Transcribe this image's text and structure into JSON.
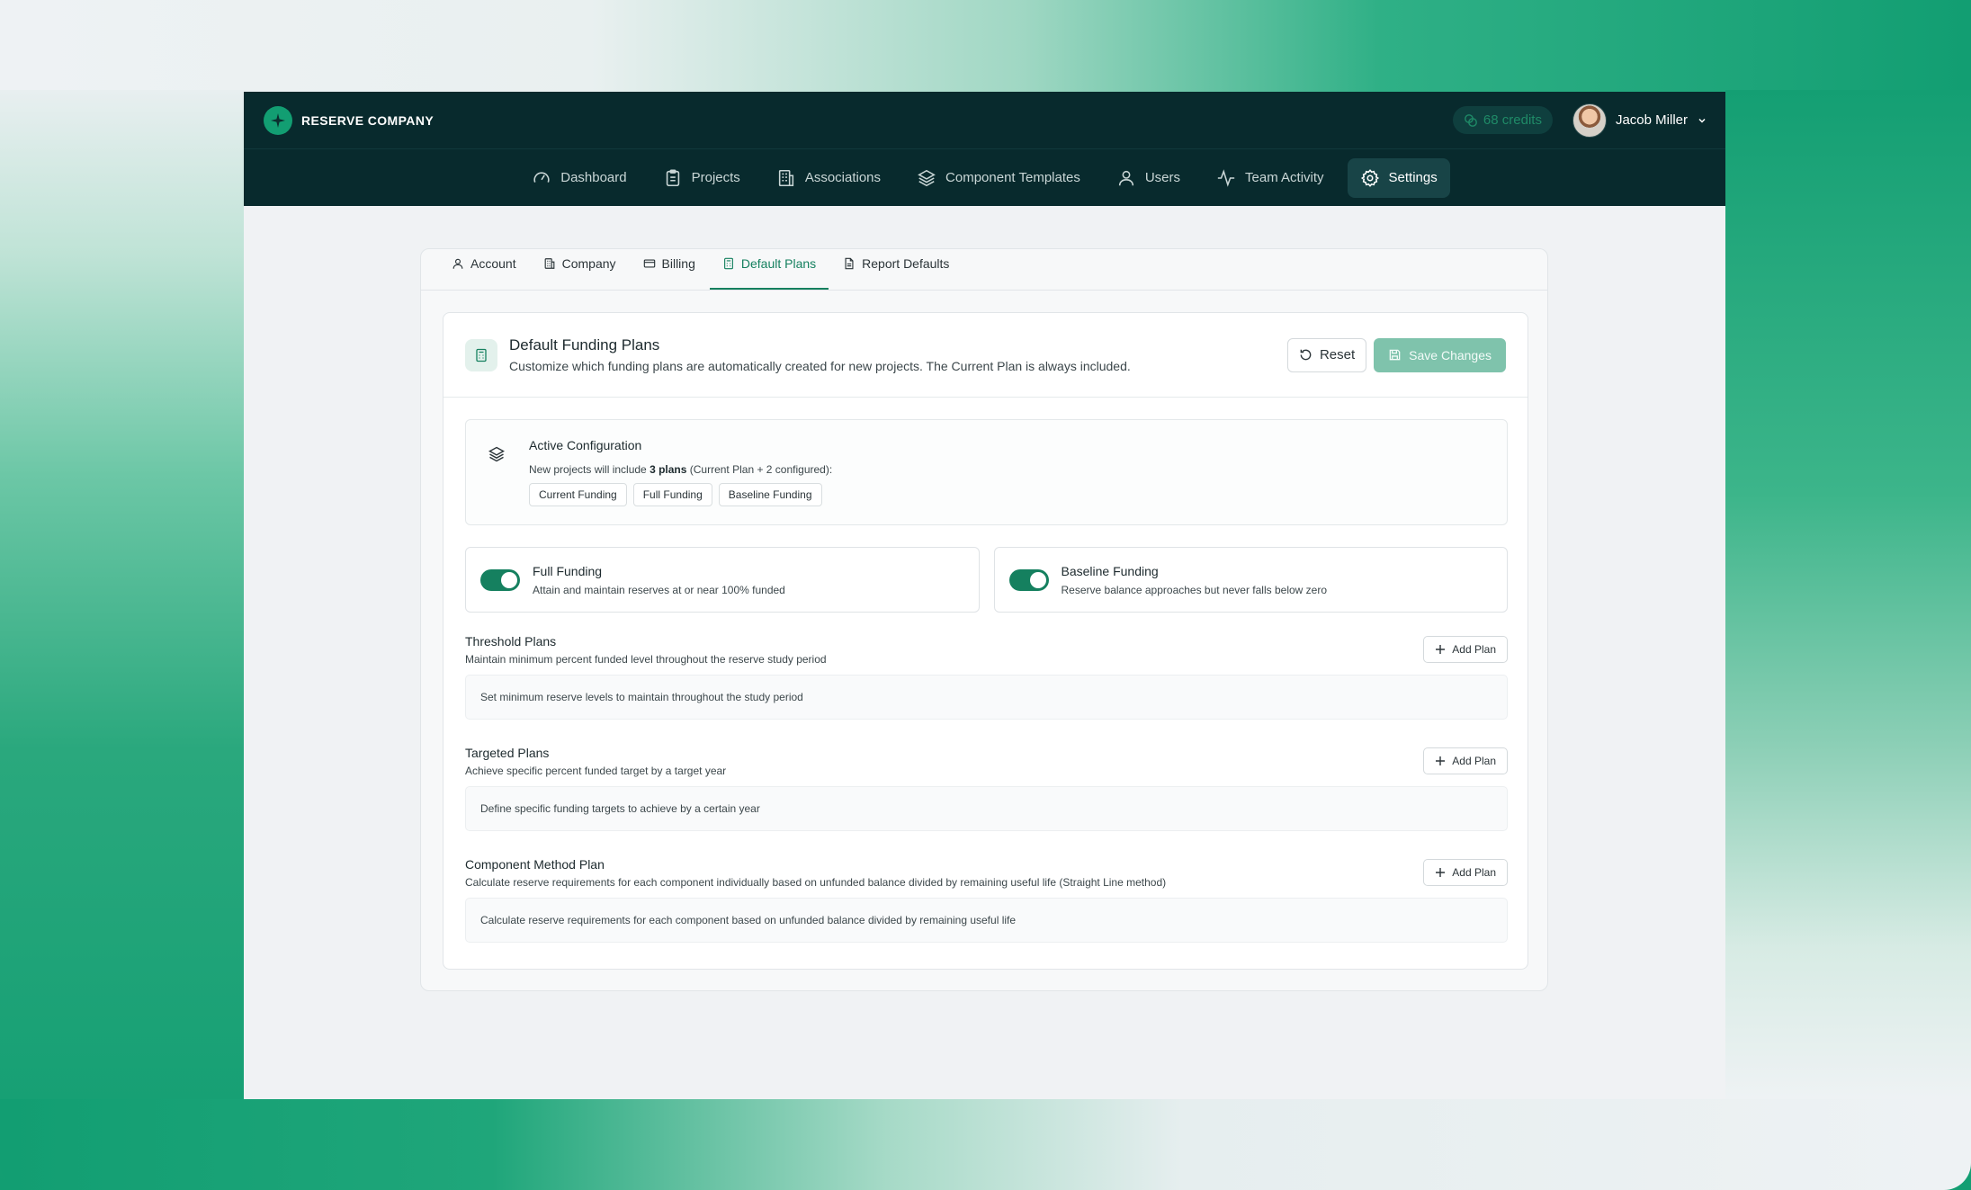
{
  "brand": {
    "name": "RESERVE COMPANY"
  },
  "topbar": {
    "credits": "68 credits",
    "user_name": "Jacob Miller"
  },
  "nav": {
    "items": [
      {
        "label": "Dashboard",
        "icon": "gauge-icon"
      },
      {
        "label": "Projects",
        "icon": "clipboard-icon"
      },
      {
        "label": "Associations",
        "icon": "building-icon"
      },
      {
        "label": "Component Templates",
        "icon": "layers-icon"
      },
      {
        "label": "Users",
        "icon": "user-icon"
      },
      {
        "label": "Team Activity",
        "icon": "activity-icon"
      },
      {
        "label": "Settings",
        "icon": "gear-icon"
      }
    ],
    "active": "Settings"
  },
  "subtabs": {
    "items": [
      {
        "label": "Account"
      },
      {
        "label": "Company"
      },
      {
        "label": "Billing"
      },
      {
        "label": "Default Plans"
      },
      {
        "label": "Report Defaults"
      }
    ],
    "active": "Default Plans"
  },
  "section": {
    "title": "Default Funding Plans",
    "description": "Customize which funding plans are automatically created for new projects. The Current Plan is always included.",
    "reset_label": "Reset",
    "save_label": "Save Changes"
  },
  "config": {
    "title": "Active Configuration",
    "sub_prefix": "New projects will include ",
    "sub_bold": "3 plans",
    "sub_suffix": " (Current Plan + 2 configured):",
    "chips": [
      "Current Funding",
      "Full Funding",
      "Baseline Funding"
    ]
  },
  "toggles": [
    {
      "title": "Full Funding",
      "description": "Attain and maintain reserves at or near 100% funded",
      "enabled": true
    },
    {
      "title": "Baseline Funding",
      "description": "Reserve balance approaches but never falls below zero",
      "enabled": true
    }
  ],
  "plans": [
    {
      "title": "Threshold Plans",
      "description": "Maintain minimum percent funded level throughout the reserve study period",
      "add_label": "Add Plan",
      "empty_text": "Set minimum reserve levels to maintain throughout the study period"
    },
    {
      "title": "Targeted Plans",
      "description": "Achieve specific percent funded target by a target year",
      "add_label": "Add Plan",
      "empty_text": "Define specific funding targets to achieve by a certain year"
    },
    {
      "title": "Component Method Plan",
      "description": "Calculate reserve requirements for each component individually based on unfunded balance divided by remaining useful life (Straight Line method)",
      "add_label": "Add Plan",
      "empty_text": "Calculate reserve requirements for each component based on unfunded balance divided by remaining useful life"
    }
  ],
  "colors": {
    "brand_dark": "#082a2d",
    "accent": "#15805f",
    "save_disabled": "#7fc3ac"
  }
}
